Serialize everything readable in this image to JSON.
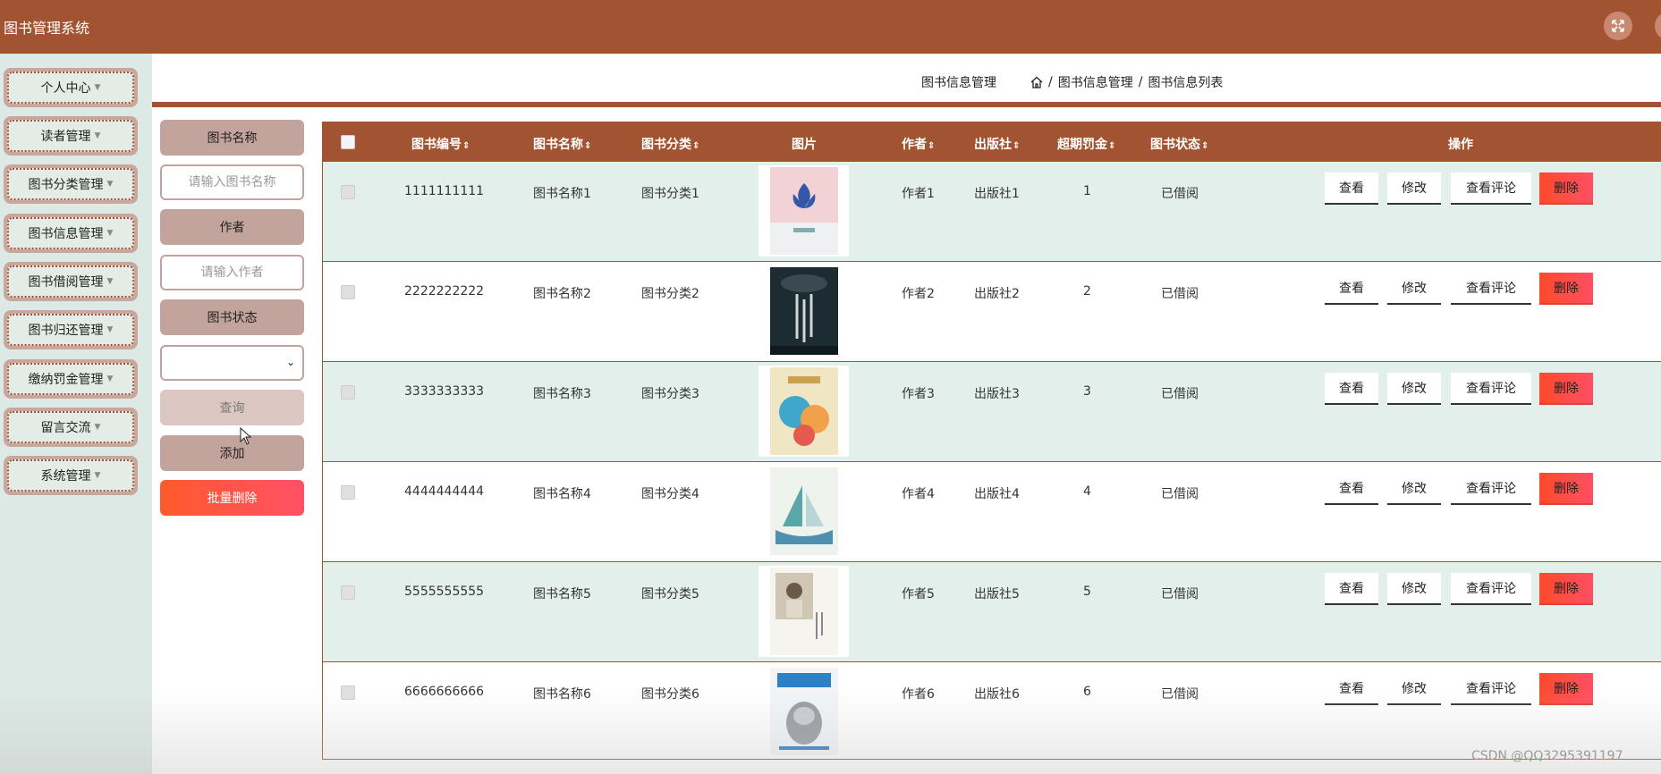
{
  "app": {
    "title": "图书管理系统"
  },
  "sidebar": {
    "items": [
      {
        "label": "个人中心"
      },
      {
        "label": "读者管理"
      },
      {
        "label": "图书分类管理"
      },
      {
        "label": "图书信息管理"
      },
      {
        "label": "图书借阅管理"
      },
      {
        "label": "图书归还管理"
      },
      {
        "label": "缴纳罚金管理"
      },
      {
        "label": "留言交流"
      },
      {
        "label": "系统管理"
      }
    ]
  },
  "breadcrumb": {
    "title": "图书信息管理",
    "path": [
      "图书信息管理",
      "图书信息列表"
    ],
    "separator": "/"
  },
  "filters": {
    "name_label": "图书名称",
    "name_placeholder": "请输入图书名称",
    "author_label": "作者",
    "author_placeholder": "请输入作者",
    "status_label": "图书状态",
    "status_value": "",
    "query_label": "查询",
    "add_label": "添加",
    "bulk_delete_label": "批量删除"
  },
  "table": {
    "headers": {
      "book_no": "图书编号",
      "book_name": "图书名称",
      "category": "图书分类",
      "image": "图片",
      "author": "作者",
      "publisher": "出版社",
      "fine": "超期罚金",
      "status": "图书状态",
      "actions": "操作"
    },
    "actions": {
      "view": "查看",
      "edit": "修改",
      "comments": "查看评论",
      "delete": "删除"
    },
    "rows": [
      {
        "book_no": "1111111111",
        "book_name": "图书名称1",
        "category": "图书分类1",
        "author": "作者1",
        "publisher": "出版社1",
        "fine": "1",
        "status": "已借阅",
        "cover": "book-cover-lotus"
      },
      {
        "book_no": "2222222222",
        "book_name": "图书名称2",
        "category": "图书分类2",
        "author": "作者2",
        "publisher": "出版社2",
        "fine": "2",
        "status": "已借阅",
        "cover": "book-cover-dark"
      },
      {
        "book_no": "3333333333",
        "book_name": "图书名称3",
        "category": "图书分类3",
        "author": "作者3",
        "publisher": "出版社3",
        "fine": "3",
        "status": "已借阅",
        "cover": "book-cover-colorful"
      },
      {
        "book_no": "4444444444",
        "book_name": "图书名称4",
        "category": "图书分类4",
        "author": "作者4",
        "publisher": "出版社4",
        "fine": "4",
        "status": "已借阅",
        "cover": "book-cover-sailboat"
      },
      {
        "book_no": "5555555555",
        "book_name": "图书名称5",
        "category": "图书分类5",
        "author": "作者5",
        "publisher": "出版社5",
        "fine": "5",
        "status": "已借阅",
        "cover": "book-cover-portrait"
      },
      {
        "book_no": "6666666666",
        "book_name": "图书名称6",
        "category": "图书分类6",
        "author": "作者6",
        "publisher": "出版社6",
        "fine": "6",
        "status": "已借阅",
        "cover": "book-cover-sketch"
      }
    ]
  },
  "colors": {
    "primary": "#a25432",
    "row_alt": "#e2efea",
    "danger": "#ff4f4f",
    "sidebar_bg": "#dde9e4"
  },
  "watermark": "CSDN @QQ3295391197"
}
